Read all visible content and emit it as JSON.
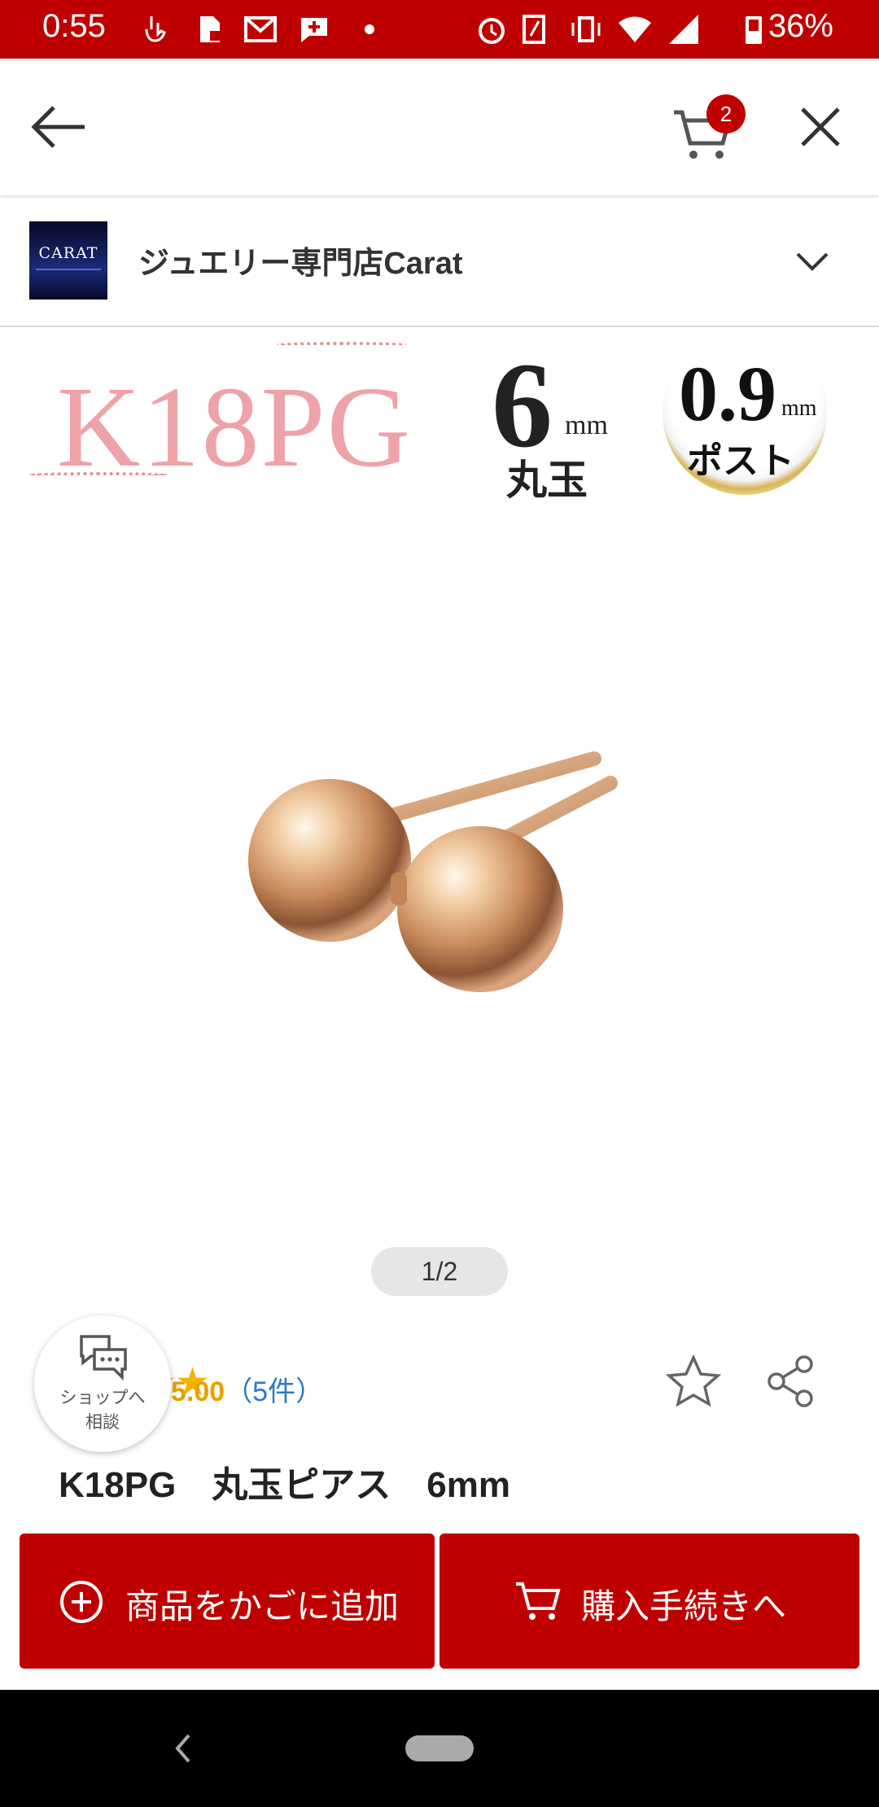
{
  "status_bar": {
    "time": "0:55",
    "battery": "36%",
    "background": "#bf0000"
  },
  "top_nav": {
    "cart_count": "2",
    "back_icon": "arrow-left-icon",
    "cart_icon": "cart-icon",
    "close_icon": "close-icon"
  },
  "shop": {
    "logo_text": "CARAT",
    "name": "ジュエリー専門店Carat",
    "expand_icon": "chevron-down-icon"
  },
  "product_image": {
    "metal_label": "K18PG",
    "ball_size": "6",
    "ball_size_unit": "mm",
    "ball_label": "丸玉",
    "post_size": "0.9",
    "post_size_unit": "mm",
    "post_label": "ポスト",
    "pager": "1/2"
  },
  "consult": {
    "label_line1": "ショップへ",
    "label_line2": "相談"
  },
  "rating": {
    "stars": "★★",
    "score": "5.00",
    "count": "（5件）",
    "star_fraction": 1.0
  },
  "product": {
    "title": "K18PG　丸玉ピアス　6mm"
  },
  "actions": {
    "add_to_cart": "商品をかごに追加",
    "checkout": "購入手続きへ",
    "accent": "#bf0000"
  }
}
